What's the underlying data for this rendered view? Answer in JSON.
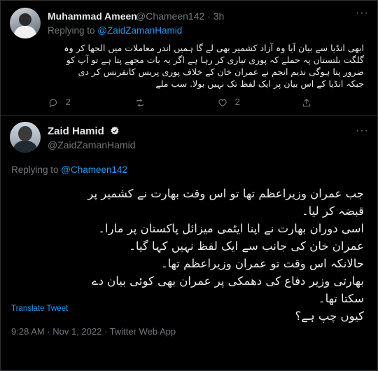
{
  "reply_tweet": {
    "author_name": "Muhammad Ameen",
    "author_handle": "@Chameen142",
    "time": "3h",
    "replying_prefix": "Replying to ",
    "replying_to": "@ZaidZamanHamid",
    "lines": [
      "ابھی انڈیا سے بیان آیا وہ آزاد کشمیر بھی لے گا ہمیں اندر معاملات میں الجھا کر وہ",
      "گلگت بلتستان پہ حملے کہ پوری تیاری کر رہا ہے اگر یہ بات مجھے پتا ہے تو آپ کو",
      "ضرور پتا ہوگی ندیم انجم نے عمران خان کے خلاف پوری پریس کانفرنس کر دی",
      "جبکہ انڈیا کے اس بیان پر ایک لفظ تک نہیں بولا. سب ملے"
    ],
    "reply_count": "2",
    "retweet_count": "",
    "like_count": "2",
    "icons": [
      "reply-icon",
      "retweet-icon",
      "like-icon",
      "share-icon",
      "more-icon"
    ]
  },
  "main_tweet": {
    "author_name": "Zaid Hamid",
    "author_handle": "@ZaidZamanHamid",
    "verified": true,
    "replying_prefix": "Replying to ",
    "replying_to": "@Chameen142",
    "lines": [
      "جب عمران وزیراعظم تھا تو اس وقت بھارت نے کشمیر پر",
      "قبضہ کر لیا۔",
      "اسی دوران بھارت نے اپنا ایٹمی میزائل پاکستان پر مارا۔",
      "عمران خان کی جانب سے ایک لفظ نہیں کہا گیا۔",
      "حالانکہ اس وقت تو عمران وزیراعظم تھا۔",
      "بھارتی وزیر دفاع کی دھمکی پر عمران بھی کوئی بیان دے",
      "سکتا تھا۔",
      "کیوں چپ ہے؟"
    ],
    "translate_label": "Translate Tweet",
    "timestamp": "9:28 AM · Nov 1, 2022 · Twitter Web App"
  },
  "colors": {
    "background": "#000000",
    "text": "#e7e9ea",
    "muted": "#71767b",
    "link": "#1d9bf0",
    "border": "#2f3336"
  }
}
